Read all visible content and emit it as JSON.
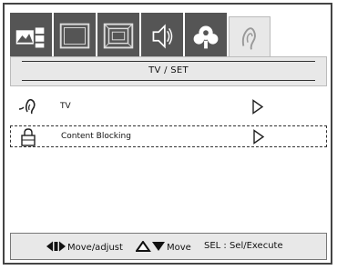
{
  "tabs": [
    {
      "name": "picture-tab",
      "icon": "picture-settings-icon",
      "active": false
    },
    {
      "name": "screen-tab",
      "icon": "screen-icon",
      "active": false
    },
    {
      "name": "zoom-tab",
      "icon": "zoom-frame-icon",
      "active": false
    },
    {
      "name": "audio-tab",
      "icon": "speaker-icon",
      "active": false
    },
    {
      "name": "network-tab",
      "icon": "satellite-icon",
      "active": false
    },
    {
      "name": "tv-set-tab",
      "icon": "ear-icon",
      "active": true
    }
  ],
  "header": {
    "title": "TV / SET"
  },
  "menu": {
    "items": [
      {
        "label": "TV",
        "icon": "ear-icon",
        "selected": false
      },
      {
        "label": "Content Blocking",
        "icon": "lock-icon",
        "selected": true
      }
    ]
  },
  "help": {
    "move_adjust": "Move/adjust",
    "move": "Move",
    "select": "SEL : Sel/Execute"
  }
}
